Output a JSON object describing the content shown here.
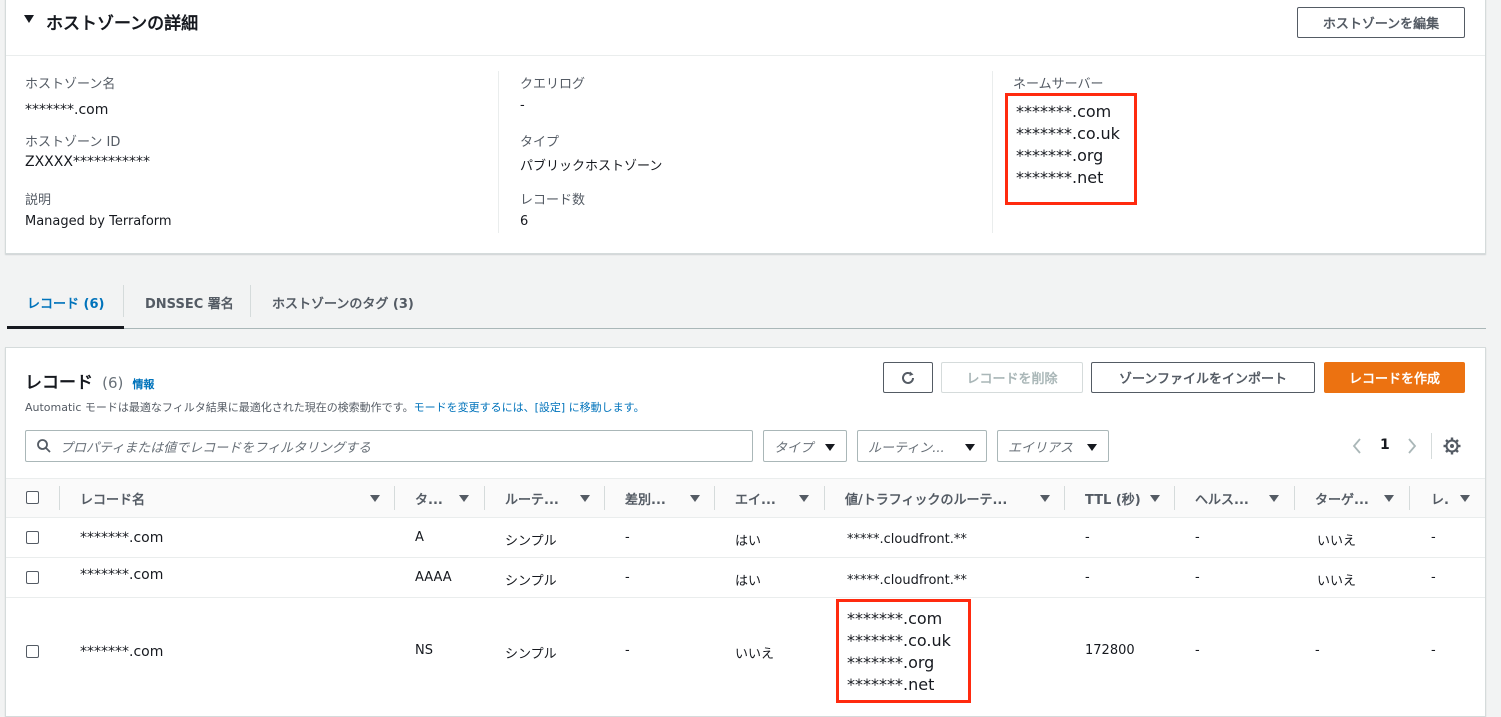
{
  "details": {
    "title": "ホストゾーンの詳細",
    "edit_button": "ホストゾーンを編集",
    "hosted_zone_name_label": "ホストゾーン名",
    "hosted_zone_name": "*******.com",
    "hosted_zone_id_label": "ホストゾーン ID",
    "hosted_zone_id": "ZXXXX***********",
    "description_label": "説明",
    "description": "Managed by Terraform",
    "query_log_label": "クエリログ",
    "query_log": "-",
    "type_label": "タイプ",
    "type": "パブリックホストゾーン",
    "record_count_label": "レコード数",
    "record_count": "6",
    "name_servers_label": "ネームサーバー",
    "name_servers": [
      "*******.com",
      "*******.co.uk",
      "*******.org",
      "*******.net"
    ]
  },
  "tabs": [
    {
      "label": "レコード (6)",
      "active": true
    },
    {
      "label": "DNSSEC 署名",
      "active": false
    },
    {
      "label": "ホストゾーンのタグ (3)",
      "active": false
    }
  ],
  "records": {
    "title": "レコード",
    "count": "(6)",
    "info": "情報",
    "desc_text": "Automatic モードは最適なフィルタ結果に最適化された現在の検索動作です。",
    "desc_link": "モードを変更するには、[設定] に移動します。",
    "refresh_icon": "refresh-icon",
    "delete_button": "レコードを削除",
    "import_button": "ゾーンファイルをインポート",
    "create_button": "レコードを作成",
    "search_placeholder": "プロパティまたは値でレコードをフィルタリングする",
    "filter_type": "タイプ",
    "filter_routing": "ルーティン...",
    "filter_alias": "エイリアス",
    "page": "1",
    "accent_color": "#ec7211",
    "link_color": "#0073bb",
    "highlight_color": "#ff2a0f",
    "columns": [
      "レコード名",
      "タ...",
      "ルーテ...",
      "差別...",
      "エイ...",
      "値/トラフィックのルーテ...",
      "TTL (秒)",
      "ヘルス...",
      "ターゲ...",
      "レ."
    ],
    "rows": [
      {
        "name": "*******.com",
        "type": "A",
        "routing": "シンプル",
        "diff": "-",
        "alias": "はい",
        "value": [
          "*****.cloudfront.**"
        ],
        "ttl": "-",
        "health": "-",
        "target": "いいえ",
        "rec": "-"
      },
      {
        "name": "*******.com",
        "type": "AAAA",
        "routing": "シンプル",
        "diff": "-",
        "alias": "はい",
        "value": [
          "*****.cloudfront.**"
        ],
        "ttl": "-",
        "health": "-",
        "target": "いいえ",
        "rec": "-"
      },
      {
        "name": "*******.com",
        "type": "NS",
        "routing": "シンプル",
        "diff": "-",
        "alias": "いいえ",
        "value": [
          "*******.com",
          "*******.co.uk",
          "*******.org",
          "*******.net"
        ],
        "ttl": "172800",
        "health": "-",
        "target": "-",
        "rec": "-"
      }
    ]
  }
}
